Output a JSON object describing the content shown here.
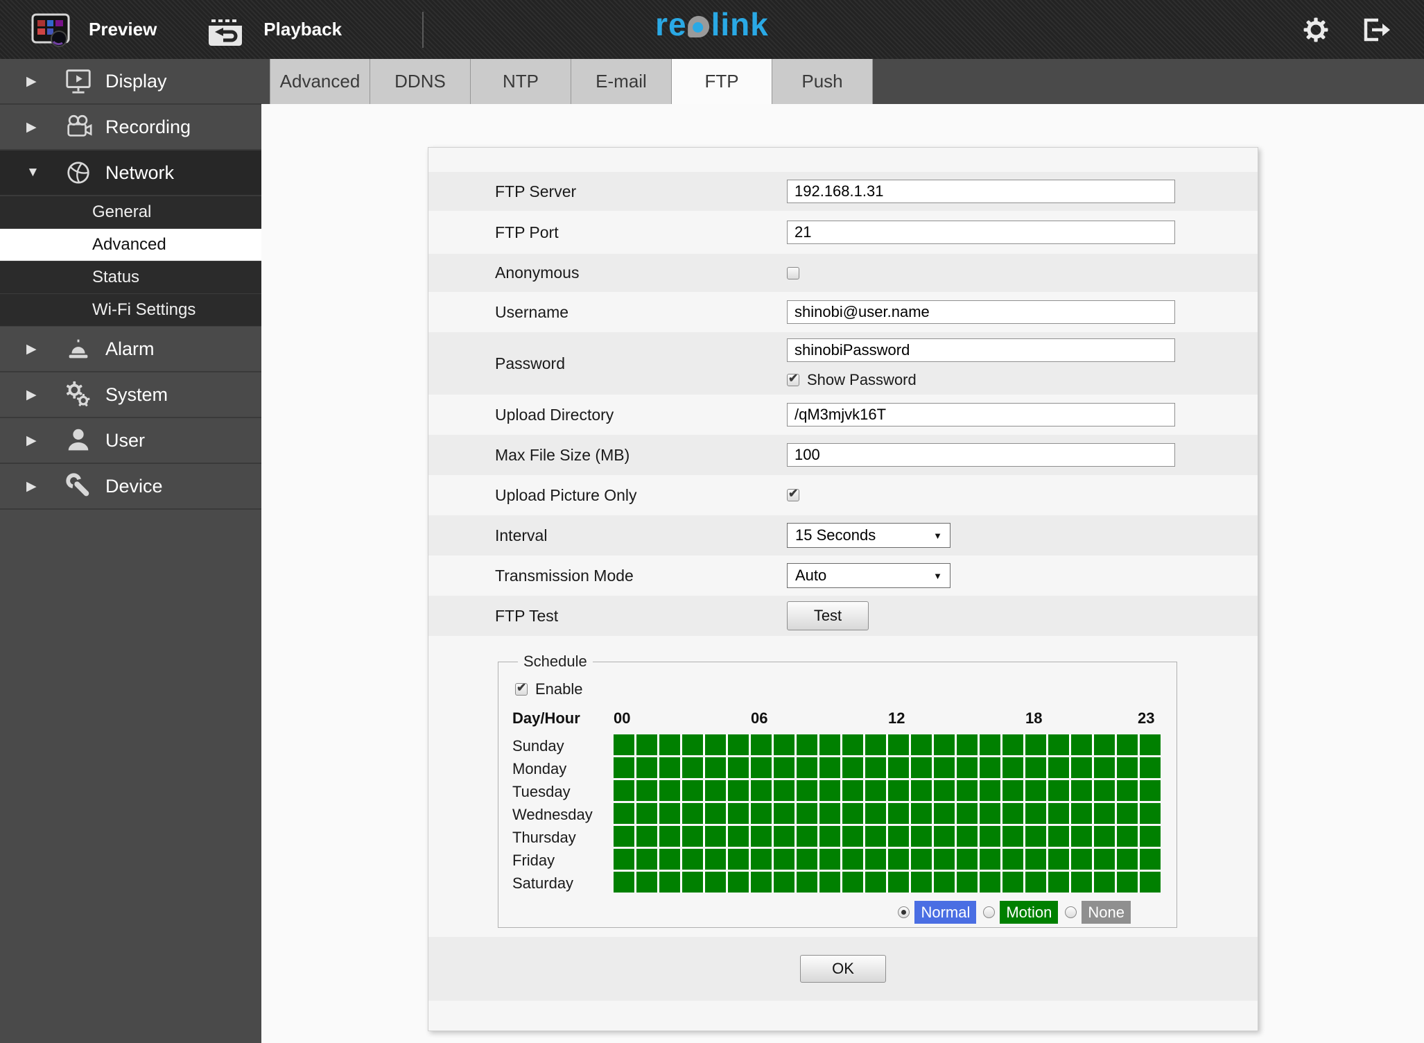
{
  "topbar": {
    "preview_label": "Preview",
    "playback_label": "Playback",
    "logo": {
      "text": "reolink",
      "left": "re",
      "mid": "o",
      "right": "link"
    },
    "icons": {
      "settings": "gear",
      "logout": "exit-arrow"
    }
  },
  "sidebar": {
    "collapsed_caret": "▶",
    "expanded_caret": "▼",
    "items": [
      {
        "label": "Display",
        "icon": "display-icon",
        "state": "collapsed"
      },
      {
        "label": "Recording",
        "icon": "recording-icon",
        "state": "collapsed"
      },
      {
        "label": "Network",
        "icon": "network-icon",
        "state": "expanded",
        "children": [
          {
            "label": "General",
            "selected": false
          },
          {
            "label": "Advanced",
            "selected": true
          },
          {
            "label": "Status",
            "selected": false
          },
          {
            "label": "Wi-Fi Settings",
            "selected": false
          }
        ]
      },
      {
        "label": "Alarm",
        "icon": "alarm-icon",
        "state": "collapsed"
      },
      {
        "label": "System",
        "icon": "system-icon",
        "state": "collapsed"
      },
      {
        "label": "User",
        "icon": "user-icon",
        "state": "collapsed"
      },
      {
        "label": "Device",
        "icon": "device-icon",
        "state": "collapsed"
      }
    ]
  },
  "tabs": {
    "labels": [
      "Advanced",
      "DDNS",
      "NTP",
      "E-mail",
      "FTP",
      "Push"
    ],
    "active": "FTP"
  },
  "form": {
    "select_arrow": "▼",
    "ftp_server": {
      "label": "FTP Server",
      "value": "192.168.1.31"
    },
    "ftp_port": {
      "label": "FTP Port",
      "value": "21"
    },
    "anonymous": {
      "label": "Anonymous",
      "checked": false
    },
    "username": {
      "label": "Username",
      "value": "shinobi@user.name"
    },
    "password": {
      "label": "Password",
      "value": "shinobiPassword",
      "show_password_label": "Show Password",
      "show_password_checked": true
    },
    "upload_directory": {
      "label": "Upload Directory",
      "value": "/qM3mjvk16T"
    },
    "max_file_size": {
      "label": "Max File Size (MB)",
      "value": "100"
    },
    "upload_picture_only": {
      "label": "Upload Picture Only",
      "checked": true
    },
    "interval": {
      "label": "Interval",
      "value": "15 Seconds"
    },
    "transmission_mode": {
      "label": "Transmission Mode",
      "value": "Auto"
    },
    "ftp_test": {
      "label": "FTP Test",
      "button_label": "Test"
    }
  },
  "schedule": {
    "legend": "Schedule",
    "enable_label": "Enable",
    "enable_checked": true,
    "day_hour_label": "Day/Hour",
    "hour_labels": [
      "00",
      "06",
      "12",
      "18",
      "23"
    ],
    "hour_label_columns": [
      1,
      7,
      13,
      19,
      24
    ],
    "days": [
      "Sunday",
      "Monday",
      "Tuesday",
      "Wednesday",
      "Thursday",
      "Friday",
      "Saturday"
    ],
    "grid": {
      "rows": 7,
      "cols": 24,
      "all_cells_state": "Motion",
      "cell_color": "#008000"
    },
    "modes": [
      {
        "label": "Normal",
        "color": "#4a6ee3",
        "selected": true
      },
      {
        "label": "Motion",
        "color": "#008000",
        "selected": false
      },
      {
        "label": "None",
        "color": "#8f8f8f",
        "selected": false
      }
    ]
  },
  "ok_label": "OK",
  "colors": {
    "logo_blue": "#2aa9e5",
    "schedule_green": "#008000",
    "normal_blue": "#4a6ee3",
    "none_gray": "#8f8f8f",
    "sidebar_gray": "#4a4a4a"
  }
}
